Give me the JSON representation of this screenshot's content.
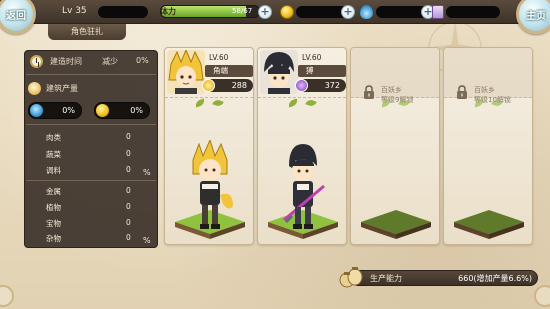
{
  "topbar": {
    "back_label": "返回",
    "main_label": "主页",
    "level": "Lv 35",
    "stamina_label": "体力",
    "stamina_value": "58/67",
    "stamina_fraction": 0.866,
    "plus": "+"
  },
  "page_title": "角色驻扎",
  "stats": {
    "build_time_label": "建造时间",
    "build_time_mod": "减少",
    "build_time_value": "0%",
    "output_label": "建筑产量",
    "gem_pct": "0%",
    "coin_pct": "0%",
    "group1": [
      {
        "label": "肉类",
        "value": "0"
      },
      {
        "label": "蔬菜",
        "value": "0"
      },
      {
        "label": "调料",
        "value": "0"
      }
    ],
    "group2": [
      {
        "label": "金属",
        "value": "0"
      },
      {
        "label": "植物",
        "value": "0"
      },
      {
        "label": "宝物",
        "value": "0"
      },
      {
        "label": "杂物",
        "value": "0"
      }
    ],
    "pct_symbol": "%"
  },
  "heroes": [
    {
      "level": "LV.60",
      "name": "角端",
      "power": "288"
    },
    {
      "level": "LV.60",
      "name": "猼",
      "power": "372"
    }
  ],
  "locked_slots": [
    {
      "line1": "百妖乡",
      "line2": "等级9解锁"
    },
    {
      "line1": "百妖乡",
      "line2": "等级10解锁"
    }
  ],
  "production": {
    "label": "生产能力",
    "value": "660(增加产量6.6%)"
  },
  "colors": {
    "accent_green": "#8fb03a",
    "panel_dark": "#3c322a"
  }
}
